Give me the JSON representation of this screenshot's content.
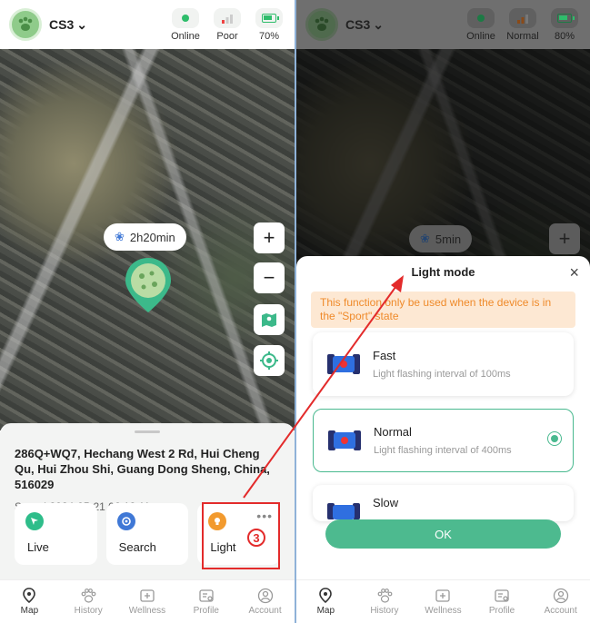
{
  "left": {
    "device_name": "CS3",
    "status": [
      {
        "label": "Online",
        "kind": "online"
      },
      {
        "label": "Poor",
        "kind": "signal"
      },
      {
        "label": "70%",
        "kind": "battery"
      }
    ],
    "map_time": "2h20min",
    "address": "286Q+WQ7, Hechang West 2 Rd, Hui Cheng Qu, Hui Zhou Shi, Guang Dong Sheng, China, 516029",
    "meta": "Sport | 2024-05-21 06:12:11",
    "actions": [
      {
        "label": "Live",
        "icon": "live-arrow-icon",
        "color": "#2ebd8a"
      },
      {
        "label": "Search",
        "icon": "search-target-icon",
        "color": "#3f78d6"
      },
      {
        "label": "Light",
        "icon": "light-bulb-icon",
        "color": "#f29a2e"
      }
    ],
    "more_label": "•••",
    "step_number": "3"
  },
  "right": {
    "device_name": "CS3",
    "status": [
      {
        "label": "Online",
        "kind": "online"
      },
      {
        "label": "Normal",
        "kind": "signal"
      },
      {
        "label": "80%",
        "kind": "battery"
      }
    ],
    "map_time": "5min",
    "modal": {
      "title": "Light mode",
      "close_label": "×",
      "notice": "This function only be used when the device is in the \"Sport\" state",
      "options": [
        {
          "name": "Fast",
          "desc": "Light flashing interval of 100ms",
          "selected": false
        },
        {
          "name": "Normal",
          "desc": "Light flashing interval of 400ms",
          "selected": true
        },
        {
          "name": "Slow",
          "desc": "",
          "selected": false
        }
      ],
      "ok_label": "OK"
    }
  },
  "tabs": [
    {
      "label": "Map",
      "icon": "map-pin-icon",
      "active": true
    },
    {
      "label": "History",
      "icon": "paw-icon",
      "active": false
    },
    {
      "label": "Wellness",
      "icon": "health-plus-icon",
      "active": false
    },
    {
      "label": "Profile",
      "icon": "profile-card-icon",
      "active": false
    },
    {
      "label": "Account",
      "icon": "account-icon",
      "active": false
    }
  ],
  "colors": {
    "accent": "#4dba8f",
    "warning": "#ef8a2a",
    "annotation": "#e32b2b"
  }
}
